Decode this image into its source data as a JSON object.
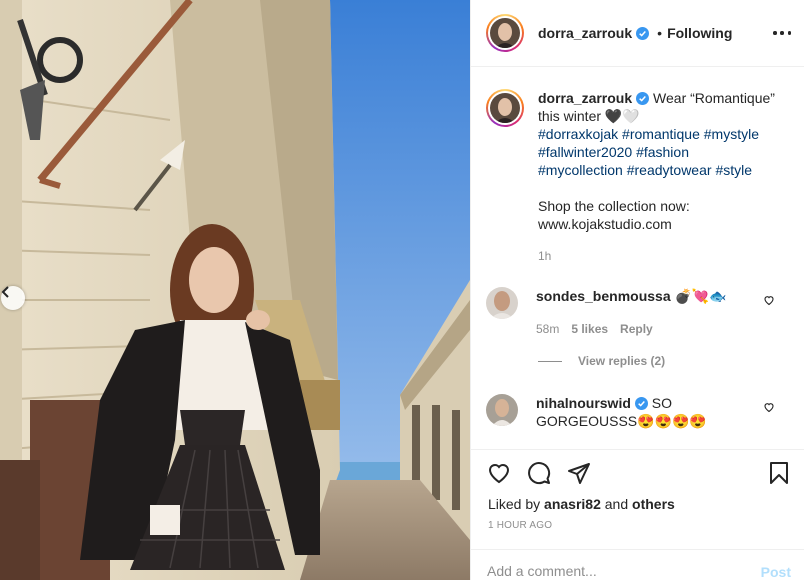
{
  "post": {
    "author": "dorra_zarrouk",
    "follow_status": "Following",
    "separator": "•",
    "caption": {
      "text": "Wear “Romantique” this winter 🖤🤍",
      "hashtags": [
        "#dorraxkojak",
        "#romantique",
        "#mystyle",
        "#fallwinter2020",
        "#fashion",
        "#mycollection",
        "#readytowear",
        "#style"
      ],
      "shop_line": "Shop the collection now:",
      "url": "www.kojakstudio.com",
      "age": "1h"
    },
    "comments": [
      {
        "username": "sondes_benmoussa",
        "text": "💣💘🐟",
        "age": "58m",
        "likes": "5 likes",
        "reply_label": "Reply",
        "view_replies": "View replies (2)"
      },
      {
        "username": "nihalnourswid",
        "text": "SO GORGEOUSSS😍😍😍😍",
        "verified": true
      }
    ],
    "liked_by": {
      "prefix": "Liked by",
      "user": "anasri82",
      "and": "and",
      "others": "others"
    },
    "timestamp": "1 HOUR AGO",
    "add_comment_placeholder": "Add a comment...",
    "post_label": "Post"
  },
  "icons": {
    "heart": "heart-icon",
    "comment": "comment-icon",
    "share": "paper-plane-icon",
    "save": "bookmark-icon",
    "more": "more-options-icon",
    "verified": "verified-badge-icon",
    "prev": "chevron-left-icon"
  },
  "colors": {
    "verified_blue": "#3897f0",
    "hashtag": "#00376b",
    "muted": "#8e8e8e",
    "post_disabled": "#b2dffc",
    "sky": "#5b95dc"
  }
}
